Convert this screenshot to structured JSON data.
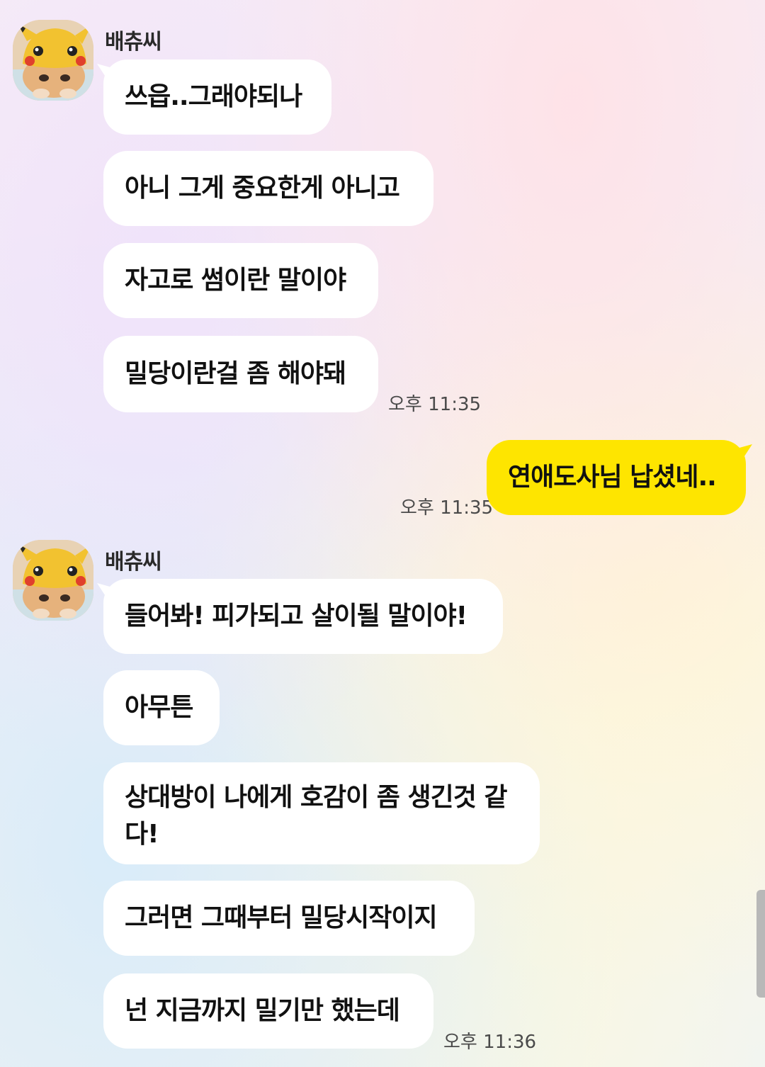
{
  "groups": [
    {
      "sender": "배츄씨",
      "avatar_icon": "pikachu-hat-cat-avatar",
      "messages": [
        "쓰읍..그래야되나",
        "아니 그게 중요한게 아니고",
        "자고로 썸이란 말이야",
        "밀당이란걸 좀 해야돼"
      ],
      "time": "오후 11:35"
    },
    {
      "mine": true,
      "messages": [
        "연애도사님 납셨네.."
      ],
      "time": "오후 11:35"
    },
    {
      "sender": "배츄씨",
      "avatar_icon": "pikachu-hat-cat-avatar",
      "messages": [
        "들어봐! 피가되고 살이될 말이야!",
        "아무튼",
        "상대방이 나에게 호감이 좀 생긴것 같다!",
        "그러면 그때부터 밀당시작이지",
        "넌 지금까지 밀기만 했는데"
      ],
      "time": "오후 11:36"
    }
  ],
  "colors": {
    "my_bubble": "#fee500",
    "other_bubble": "#ffffff"
  }
}
